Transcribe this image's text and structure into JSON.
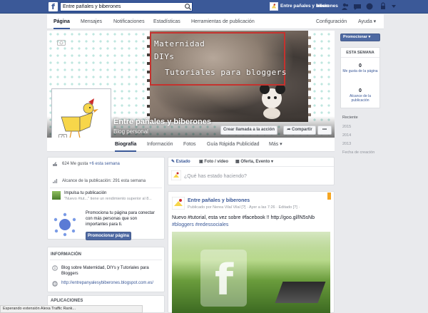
{
  "topbar": {
    "search_value": "Entre pañales y biberones",
    "page_name": "Entre pañales y biberones",
    "home": "Inicio"
  },
  "admin_tabs": [
    "Página",
    "Mensajes",
    "Notificaciones",
    "Estadísticas",
    "Herramientas de publicación"
  ],
  "admin_right": {
    "config": "Configuración",
    "help": "Ayuda ▾"
  },
  "cover": {
    "lines": [
      "Maternidad",
      "DIYs",
      "Tutoriales para bloggers"
    ],
    "title": "Entre pañales y biberones",
    "subtitle": "Blog personal",
    "btn_call": "Crear llamada a la acción",
    "btn_share": "Compartir",
    "btn_more": "•••"
  },
  "nav_tabs": [
    "Biografía",
    "Información",
    "Fotos",
    "Guía Rápida Publicidad",
    "Más ▾"
  ],
  "stats": {
    "likes": "624 Me gusta",
    "likes_week": "+6 esta semana",
    "reach_label": "Alcance de la publicación:",
    "reach_value": "291 esta semana",
    "boost_title": "Impulsa tu publicación",
    "boost_sub": "\"Nuevo #tut...\" tiene un rendimiento superior al 8...",
    "promo_text": "Promociona tu página para conectar con más personas que son importantes para ti.",
    "promo_button": "Promocionar página"
  },
  "info": {
    "header": "INFORMACIÓN",
    "desc": "Blog sobre Maternidad, DIYs y Tutoriales para Bloggers",
    "url": "http://entrepanyalesybiberones.blogspot.com.es/"
  },
  "apps": {
    "header": "APLICACIONES"
  },
  "composer": {
    "tabs": [
      "Estado",
      "Foto / vídeo",
      "Oferta, Evento ▾"
    ],
    "placeholder": "¿Qué has estado haciendo?"
  },
  "post": {
    "author": "Entre pañales y biberones",
    "meta": "Publicado por Nerea Vilal Vilal [?] · Ayer a las 7:26 · Editado [?] ·",
    "text1": "Nuevo #tutorial, esta vez sobre #facebook !! http://goo.gl/lN5sNb",
    "text2": "#bloggers #redessociales"
  },
  "right": {
    "promote": "Promocionar ▾",
    "week_header": "ESTA SEMANA",
    "n1": "0",
    "l1": "Me gusta de la página",
    "n2": "0",
    "l2": "Alcance de la publicación",
    "years": [
      "Reciente",
      "2015",
      "2014",
      "2013",
      "Fecha de creación"
    ]
  },
  "status": "Esperando extensión Alexa Traffic Rank...",
  "colors": {
    "fb_blue": "#3b5998",
    "cover_dots": "#bfe6df",
    "red_box": "#c5322e"
  }
}
